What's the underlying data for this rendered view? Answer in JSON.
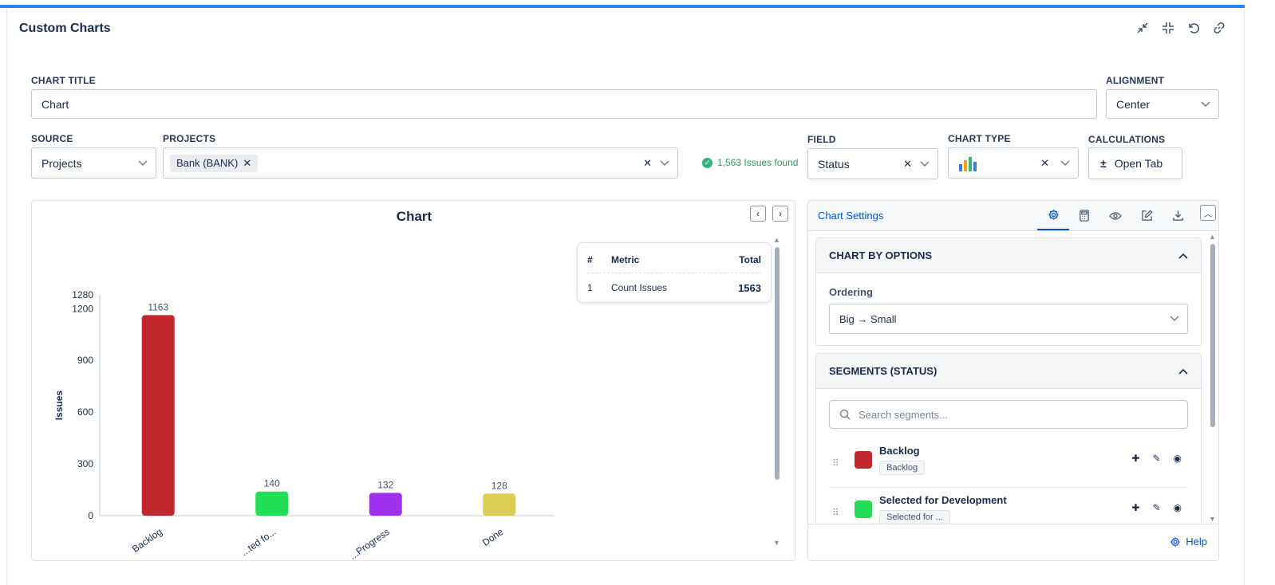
{
  "page": {
    "title": "Custom Charts"
  },
  "form": {
    "chart_title_label": "CHART TITLE",
    "chart_title_value": "Chart",
    "alignment_label": "ALIGNMENT",
    "alignment_value": "Center",
    "source_label": "SOURCE",
    "source_value": "Projects",
    "projects_label": "PROJECTS",
    "project_tag": "Bank (BANK)",
    "issues_found": "1,563 Issues found",
    "field_label": "FIELD",
    "field_value": "Status",
    "chart_type_label": "CHART TYPE",
    "calculations_label": "CALCULATIONS",
    "open_tab_label": "Open Tab"
  },
  "metrics": {
    "headers": [
      "#",
      "Metric",
      "Total"
    ],
    "rows": [
      {
        "index": "1",
        "metric": "Count Issues",
        "total": "1563"
      }
    ]
  },
  "settings": {
    "title": "Chart Settings",
    "chart_by_title": "CHART BY OPTIONS",
    "ordering_label": "Ordering",
    "ordering_value": "Big → Small",
    "segments_title": "SEGMENTS (STATUS)",
    "search_placeholder": "Search segments...",
    "segments": [
      {
        "name": "Backlog",
        "tag": "Backlog",
        "color": "#c0282d"
      },
      {
        "name": "Selected for Development",
        "tag": "Selected for ...",
        "color": "#22dd55"
      }
    ],
    "help_label": "Help"
  },
  "chart_data": {
    "type": "bar",
    "title": "Chart",
    "ylabel": "Issues",
    "categories": [
      "Backlog",
      "...ted fo...",
      "...Progress",
      "Done"
    ],
    "values": [
      1163,
      140,
      132,
      128
    ],
    "value_labels": [
      "1163",
      "140",
      "132",
      "128"
    ],
    "colors": [
      "#c0282d",
      "#22dd55",
      "#a02ff0",
      "#ddcc55"
    ],
    "ylim": [
      0,
      1280
    ],
    "yticks": [
      0,
      300,
      600,
      900,
      1200,
      1280
    ],
    "grid": false
  }
}
